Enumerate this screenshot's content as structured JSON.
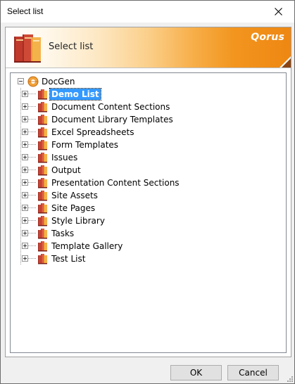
{
  "window": {
    "title": "Select list"
  },
  "banner": {
    "title": "Select list",
    "brand": "Qorus"
  },
  "tree": {
    "root": {
      "label": "DocGen"
    },
    "items": [
      {
        "label": "Demo List",
        "selected": true
      },
      {
        "label": "Document Content Sections"
      },
      {
        "label": "Document Library Templates"
      },
      {
        "label": "Excel Spreadsheets"
      },
      {
        "label": "Form Templates"
      },
      {
        "label": "Issues"
      },
      {
        "label": "Output"
      },
      {
        "label": "Presentation Content Sections"
      },
      {
        "label": "Site Assets"
      },
      {
        "label": "Site Pages"
      },
      {
        "label": "Style Library"
      },
      {
        "label": "Tasks"
      },
      {
        "label": "Template Gallery"
      },
      {
        "label": "Test List"
      }
    ]
  },
  "buttons": {
    "ok": "OK",
    "cancel": "Cancel"
  },
  "icons": {
    "close": "close-icon",
    "banner": "books-icon",
    "root": "site-globe-icon",
    "node": "list-books-icon",
    "expander": "plus-box-icon"
  },
  "colors": {
    "selection": "#3399ff",
    "banner_accent": "#ee8712",
    "book_red": "#b5332a",
    "book_orange": "#f0a132"
  }
}
